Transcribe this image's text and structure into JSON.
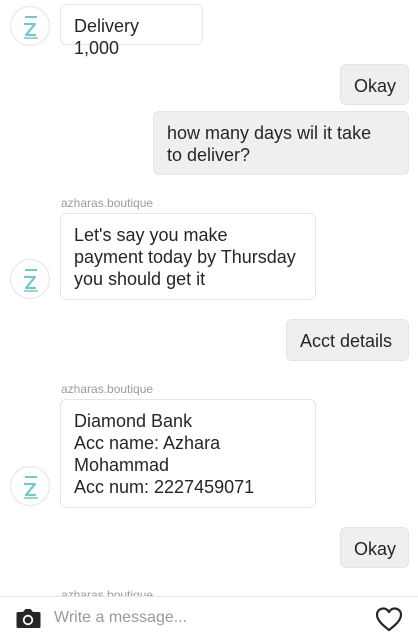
{
  "thread": {
    "messages": [
      {
        "from": "shop",
        "text": "Delivery 1,000"
      },
      {
        "from": "me",
        "text": "Okay"
      },
      {
        "from": "me",
        "text": "how many days wil it take\nto deliver?"
      },
      {
        "from": "shop",
        "sender": "azharas.boutique",
        "text": "Let's say you make\npayment today by Thursday\nyou should get it"
      },
      {
        "from": "me",
        "text": "Acct details"
      },
      {
        "from": "shop",
        "sender": "azharas.boutique",
        "text": "Diamond Bank\nAcc name: Azhara\nMohammad\nAcc num: 2227459071"
      },
      {
        "from": "me",
        "text": "Okay"
      },
      {
        "from": "shop",
        "sender": "azharas.boutique"
      }
    ]
  },
  "composer": {
    "placeholder": "Write a message...",
    "camera_icon": "camera-icon",
    "like_icon": "heart-icon"
  },
  "colors": {
    "avatar_accent": "#79c6c9",
    "incoming_bubble": "#ffffff",
    "outgoing_bubble": "#efefef",
    "sender_label": "#9b9b9b"
  }
}
